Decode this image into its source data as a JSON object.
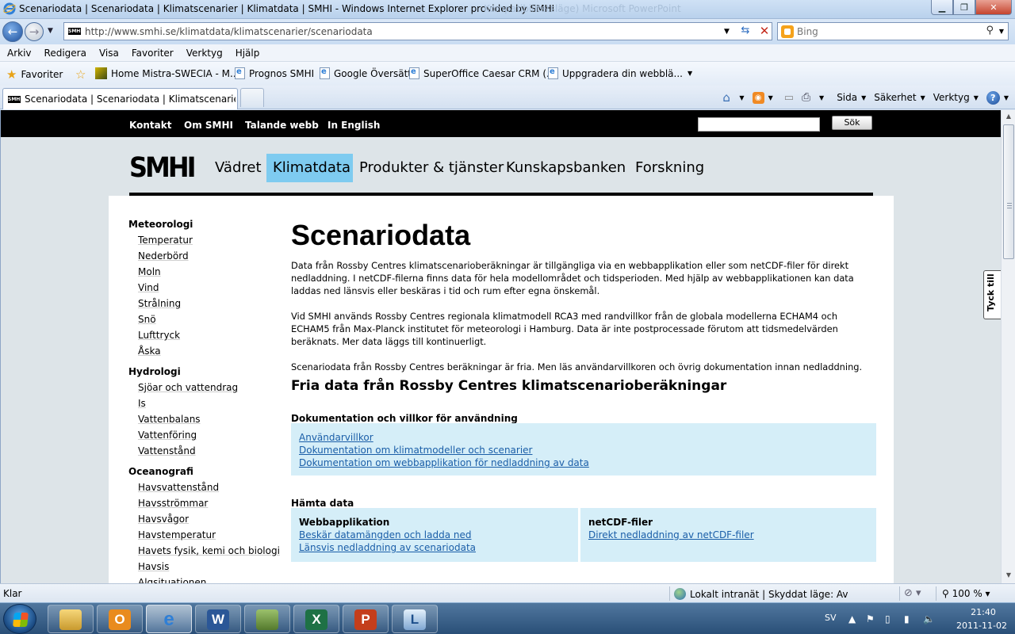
{
  "window": {
    "title": "Scenariodata | Scenariodata | Klimatscenarier | Klimatdata | SMHI - Windows Internet Explorer provided by SMHI",
    "ghost_text": "Kompatibilitetsläge)   Microsoft PowerPoint"
  },
  "address": {
    "url": "http://www.smhi.se/klimatdata/klimatscenarier/scenariodata",
    "search_placeholder": "Bing"
  },
  "menu": [
    "Arkiv",
    "Redigera",
    "Visa",
    "Favoriter",
    "Verktyg",
    "Hjälp"
  ],
  "favorites": {
    "label": "Favoriter",
    "items": [
      "Home Mistra-SWECIA - M...",
      "Prognos  SMHI",
      "Google Översätt",
      "SuperOffice Caesar CRM (...",
      "Uppgradera din webblä..."
    ]
  },
  "tab": {
    "label": "Scenariodata | Scenariodata | Klimatscenarier | Kli..."
  },
  "commands": {
    "page": "Sida",
    "safety": "Säkerhet",
    "tools": "Verktyg"
  },
  "site": {
    "topnav": [
      "Kontakt",
      "Om SMHI",
      "Talande webb",
      "In English"
    ],
    "search_button": "Sök",
    "brand": "SMHI",
    "mainnav": [
      "Vädret",
      "Klimatdata",
      "Produkter & tjänster",
      "Kunskapsbanken",
      "Forskning"
    ],
    "active_nav": "Klimatdata",
    "feedback": "Tyck till"
  },
  "sidebar": {
    "sections": [
      {
        "heading": "Meteorologi",
        "items": [
          "Temperatur",
          "Nederbörd",
          "Moln",
          "Vind",
          "Strålning",
          "Snö",
          "Lufttryck",
          "Åska"
        ]
      },
      {
        "heading": "Hydrologi",
        "items": [
          "Sjöar och vattendrag",
          "Is",
          "Vattenbalans",
          "Vattenföring",
          "Vattenstånd"
        ]
      },
      {
        "heading": "Oceanografi",
        "items": [
          "Havsvattenstånd",
          "Havsströmmar",
          "Havsvågor",
          "Havstemperatur",
          "Havets fysik, kemi och biologi",
          "Havsis",
          "Algsituationen"
        ]
      }
    ]
  },
  "main": {
    "title": "Scenariodata",
    "para1": "Data från Rossby Centres klimatscenarioberäkningar är tillgängliga via en webbapplikation eller som netCDF-filer för direkt nedladdning. I netCDF-filerna finns data för hela modellområdet och tidsperioden. Med hjälp av webbapplikationen kan data laddas ned länsvis eller beskäras i tid och rum efter egna önskemål.",
    "para2": "Vid SMHI används Rossby Centres regionala klimatmodell RCA3 med randvillkor från de globala modellerna ECHAM4 och ECHAM5 från Max-Planck institutet för meteorologi i Hamburg. Data är inte postprocessade förutom att tidsmedelvärden beräknats. Mer data läggs till kontinuerligt.",
    "para3": "Scenariodata från Rossby Centres beräkningar är fria. Men läs användarvillkoren och övrig dokumentation innan nedladdning.",
    "h2": "Fria data från Rossby Centres klimatscenarioberäkningar",
    "doc_heading": "Dokumentation och villkor för användning",
    "doc_links": [
      "Användarvillkor",
      "Dokumentation om klimatmodeller och scenarier",
      "Dokumentation om webbapplikation för nedladdning av data"
    ],
    "download_heading": "Hämta data",
    "webapp": {
      "heading": "Webbapplikation",
      "links": [
        "Beskär datamängden och ladda ned",
        "Länsvis nedladdning av scenariodata"
      ]
    },
    "netcdf": {
      "heading": "netCDF-filer",
      "links": [
        "Direkt nedladdning av netCDF-filer"
      ]
    }
  },
  "status": {
    "text": "Klar",
    "zone": "Lokalt intranät | Skyddat läge: Av",
    "zoom": "100 %"
  },
  "taskbar": {
    "lang": "SV",
    "time": "21:40",
    "date": "2011-11-02"
  },
  "colors": {
    "active_nav": "#7ecbf0",
    "box": "#d5eef8",
    "link": "#1a5ea8"
  }
}
